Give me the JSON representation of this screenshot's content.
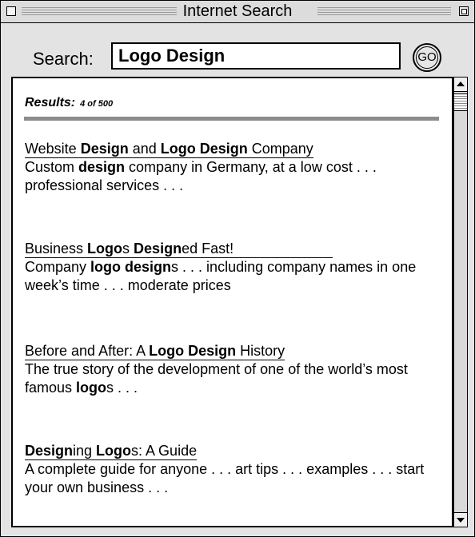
{
  "window": {
    "title": "Internet Search"
  },
  "search": {
    "label": "Search:",
    "value": "Logo Design",
    "button_label": "GO"
  },
  "results": {
    "label": "Results:",
    "count": "4 of 500",
    "items": [
      {
        "title": [
          {
            "t": "Website "
          },
          {
            "t": "Design",
            "b": true
          },
          {
            "t": " and "
          },
          {
            "t": "Logo Design",
            "b": true
          },
          {
            "t": " Company"
          }
        ],
        "snippet": [
          {
            "t": "Custom "
          },
          {
            "t": "design",
            "b": true
          },
          {
            "t": " company in Germany, at a low cost . . . professional services . . ."
          }
        ]
      },
      {
        "title": [
          {
            "t": "Business "
          },
          {
            "t": "Logo",
            "b": true
          },
          {
            "t": "s "
          },
          {
            "t": "Design",
            "b": true
          },
          {
            "t": "ed Fast!"
          }
        ],
        "snippet": [
          {
            "t": "Company "
          },
          {
            "t": "logo design",
            "b": true
          },
          {
            "t": "s . . . including company names in one week’s time . . . moderate prices"
          }
        ]
      },
      {
        "title": [
          {
            "t": "Before and After: A "
          },
          {
            "t": "Logo Design",
            "b": true
          },
          {
            "t": " History"
          }
        ],
        "snippet": [
          {
            "t": "The true story of the development of one of the world’s most famous "
          },
          {
            "t": "logo",
            "b": true
          },
          {
            "t": "s . . ."
          }
        ]
      },
      {
        "title": [
          {
            "t": "Design",
            "b": true
          },
          {
            "t": "ing "
          },
          {
            "t": "Logo",
            "b": true
          },
          {
            "t": "s: A Guide"
          }
        ],
        "snippet": [
          {
            "t": "A complete guide for anyone . . . art tips . . . examples . . . start your own business . . ."
          }
        ]
      }
    ]
  }
}
